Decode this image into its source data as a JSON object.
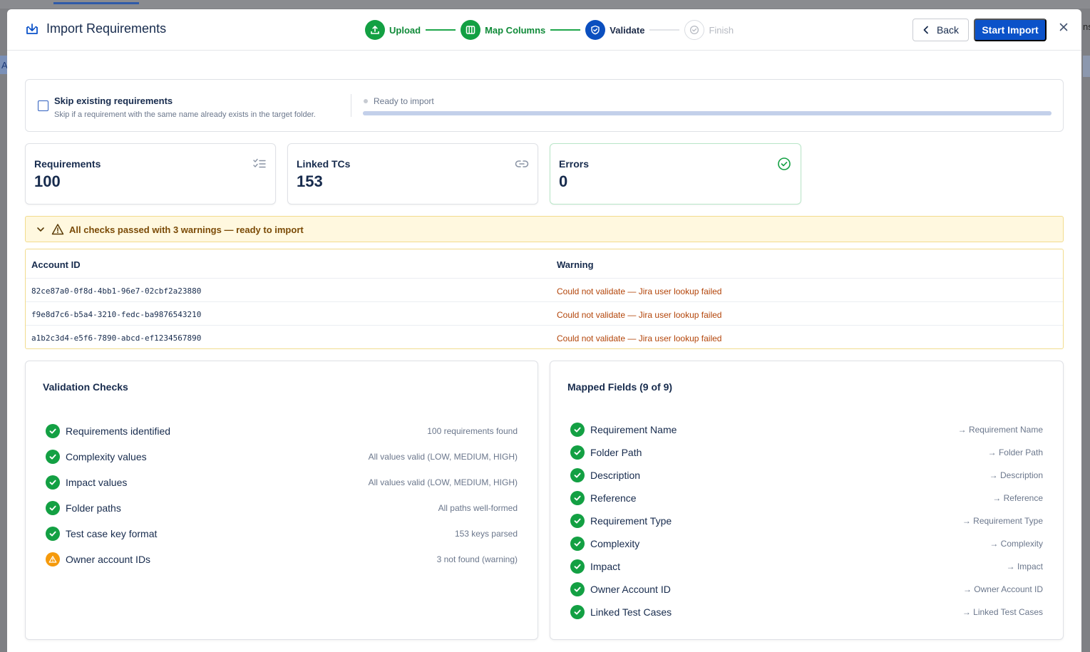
{
  "backdrop": {
    "left_letter": "A",
    "right_text": "ns"
  },
  "header": {
    "title": "Import Requirements",
    "steps": [
      {
        "label": "Upload",
        "state": "done",
        "icon": "upload-icon"
      },
      {
        "label": "Map Columns",
        "state": "done",
        "icon": "columns-icon"
      },
      {
        "label": "Validate",
        "state": "current",
        "icon": "shield-icon"
      },
      {
        "label": "Finish",
        "state": "pending",
        "icon": "check-circle-icon"
      }
    ],
    "back_label": "Back",
    "start_label": "Start Import"
  },
  "options": {
    "skip_title": "Skip existing requirements",
    "skip_desc": "Skip if a requirement with the same name already exists in the target folder.",
    "skip_checked": false,
    "ready_text": "Ready to import",
    "progress_fraction": 1.0
  },
  "stats": [
    {
      "label": "Requirements",
      "value": "100",
      "icon": "checklist-icon"
    },
    {
      "label": "Linked TCs",
      "value": "153",
      "icon": "link-icon"
    },
    {
      "label": "Errors",
      "value": "0",
      "icon": "check-circle-icon"
    }
  ],
  "warning_banner": {
    "text": "All checks passed with 3 warnings — ready to import",
    "table": {
      "columns": [
        "Account ID",
        "Warning"
      ],
      "rows": [
        {
          "id": "82ce87a0-0f8d-4bb1-96e7-02cbf2a23880",
          "warning": "Could not validate — Jira user lookup failed"
        },
        {
          "id": "f9e8d7c6-b5a4-3210-fedc-ba9876543210",
          "warning": "Could not validate — Jira user lookup failed"
        },
        {
          "id": "a1b2c3d4-e5f6-7890-abcd-ef1234567890",
          "warning": "Could not validate — Jira user lookup failed"
        }
      ]
    }
  },
  "validation": {
    "title": "Validation Checks",
    "checks": [
      {
        "label": "Requirements identified",
        "detail": "100 requirements found",
        "status": "ok"
      },
      {
        "label": "Complexity values",
        "detail": "All values valid (LOW, MEDIUM, HIGH)",
        "status": "ok"
      },
      {
        "label": "Impact values",
        "detail": "All values valid (LOW, MEDIUM, HIGH)",
        "status": "ok"
      },
      {
        "label": "Folder paths",
        "detail": "All paths well-formed",
        "status": "ok"
      },
      {
        "label": "Test case key format",
        "detail": "153 keys parsed",
        "status": "ok"
      },
      {
        "label": "Owner account IDs",
        "detail": "3 not found (warning)",
        "status": "warn"
      }
    ]
  },
  "mapped": {
    "title": "Mapped Fields (9 of 9)",
    "fields": [
      {
        "label": "Requirement Name",
        "target": "→ Requirement Name"
      },
      {
        "label": "Folder Path",
        "target": "→ Folder Path"
      },
      {
        "label": "Description",
        "target": "→ Description"
      },
      {
        "label": "Reference",
        "target": "→ Reference"
      },
      {
        "label": "Requirement Type",
        "target": "→ Requirement Type"
      },
      {
        "label": "Complexity",
        "target": "→ Complexity"
      },
      {
        "label": "Impact",
        "target": "→ Impact"
      },
      {
        "label": "Owner Account ID",
        "target": "→ Owner Account ID"
      },
      {
        "label": "Linked Test Cases",
        "target": "→ Linked Test Cases"
      }
    ]
  },
  "colors": {
    "success": "#13a043",
    "primary": "#0b52c9",
    "warning": "#f59a0c",
    "warning_text": "#b3450a"
  }
}
